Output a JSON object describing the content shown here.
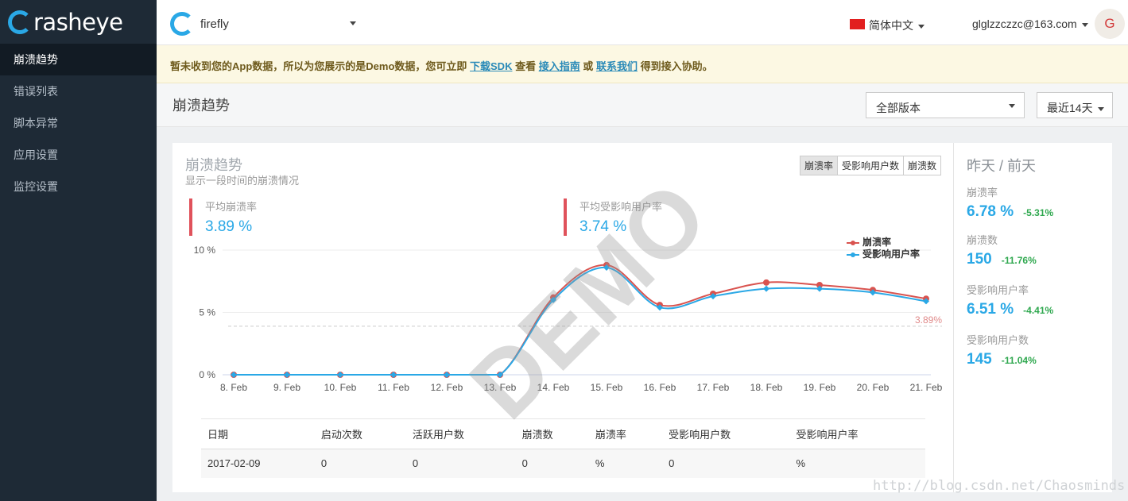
{
  "brand": {
    "name": "rasheye"
  },
  "sidebar": {
    "items": [
      {
        "label": "崩溃趋势",
        "active": true
      },
      {
        "label": "错误列表",
        "active": false
      },
      {
        "label": "脚本异常",
        "active": false
      },
      {
        "label": "应用设置",
        "active": false
      },
      {
        "label": "监控设置",
        "active": false
      }
    ]
  },
  "topbar": {
    "app_name": "firefly",
    "language": "简体中文",
    "email": "glglzzczzc@163.com",
    "avatar_letter": "G"
  },
  "notice": {
    "text1": "暂未收到您的App数据，所以为您展示的是Demo数据，您可立即 ",
    "link1": "下载SDK",
    "text2": " 查看 ",
    "link2": "接入指南",
    "text3": " 或 ",
    "link3": "联系我们",
    "text4": " 得到接入协助。"
  },
  "page": {
    "title": "崩溃趋势",
    "version_select": "全部版本",
    "range_select": "最近14天"
  },
  "panel": {
    "title": "崩溃趋势",
    "subtitle": "显示一段时间的崩溃情况",
    "toggles": [
      "崩溃率",
      "受影响用户数",
      "崩溃数"
    ],
    "stat1": {
      "label": "平均崩溃率",
      "value": "3.89 %"
    },
    "stat2": {
      "label": "平均受影响用户率",
      "value": "3.74 %"
    },
    "demo_mark": "DEMO"
  },
  "chart_data": {
    "type": "line",
    "x": [
      "8. Feb",
      "9. Feb",
      "10. Feb",
      "11. Feb",
      "12. Feb",
      "13. Feb",
      "14. Feb",
      "15. Feb",
      "16. Feb",
      "17. Feb",
      "18. Feb",
      "19. Feb",
      "20. Feb",
      "21. Feb"
    ],
    "series": [
      {
        "name": "崩溃率",
        "color": "#d9534f",
        "values": [
          0,
          0,
          0,
          0,
          0,
          0,
          6.2,
          8.8,
          5.6,
          6.5,
          7.4,
          7.2,
          6.8,
          6.1
        ]
      },
      {
        "name": "受影响用户率",
        "color": "#2aa8e6",
        "values": [
          0,
          0,
          0,
          0,
          0,
          0,
          6.0,
          8.6,
          5.4,
          6.3,
          6.9,
          6.9,
          6.6,
          5.9
        ]
      }
    ],
    "yticks": [
      "0 %",
      "5 %",
      "10 %"
    ],
    "ylim": [
      0,
      10
    ],
    "reference_line": {
      "value": 3.89,
      "label": "3.89%"
    }
  },
  "table": {
    "headers": [
      "日期",
      "启动次数",
      "活跃用户数",
      "崩溃数",
      "崩溃率",
      "受影响用户数",
      "受影响用户率"
    ],
    "rows": [
      [
        "2017-02-09",
        "0",
        "0",
        "0",
        "%",
        "0",
        "%"
      ]
    ]
  },
  "right": {
    "title": "昨天 / 前天",
    "stats": [
      {
        "label": "崩溃率",
        "value": "6.78 %",
        "delta": "-5.31%"
      },
      {
        "label": "崩溃数",
        "value": "150",
        "delta": "-11.76%"
      },
      {
        "label": "受影响用户率",
        "value": "6.51 %",
        "delta": "-4.41%"
      },
      {
        "label": "受影响用户数",
        "value": "145",
        "delta": "-11.04%"
      }
    ]
  },
  "watermark": "http://blog.csdn.net/Chaosminds"
}
